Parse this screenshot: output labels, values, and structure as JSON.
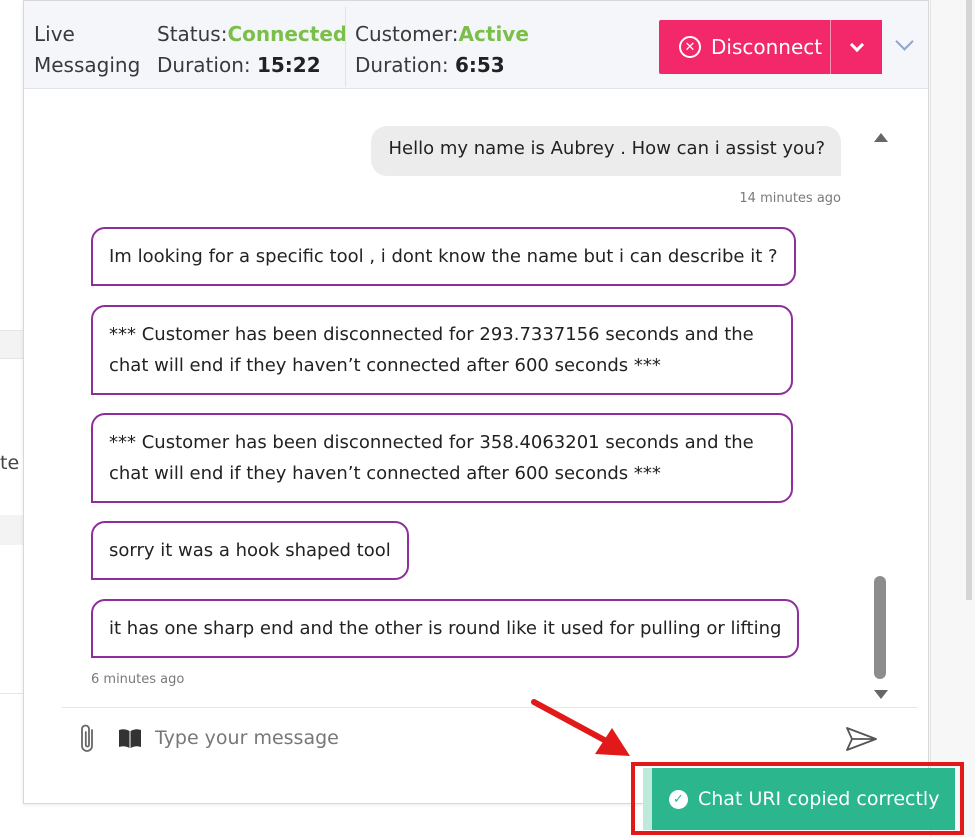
{
  "header": {
    "title_line1": "Live",
    "title_line2": "Messaging",
    "status_label": "Status:",
    "status_value": "Connected",
    "duration_label": "Duration:",
    "duration_value": "15:22",
    "customer_label": "Customer:",
    "customer_value": "Active",
    "customer_duration_label": "Duration:",
    "customer_duration_value": "6:53",
    "disconnect_label": "Disconnect",
    "accent_color": "#f2286b",
    "status_color": "#7bbf4a"
  },
  "background": {
    "partial_text": "te"
  },
  "messages": {
    "agent": {
      "text": "Hello my name is Aubrey . How can i assist you?",
      "time": "14 minutes ago"
    },
    "customer": [
      {
        "text": "Im looking for a specific tool , i dont know the name but i can describe it ?"
      },
      {
        "text": "*** Customer has been disconnected for 293.7337156 seconds and the chat will end if they haven’t connected after 600 seconds ***"
      },
      {
        "text": "*** Customer has been disconnected for 358.4063201 seconds and the chat will end if they haven’t connected after 600 seconds ***"
      },
      {
        "text": "sorry it was a hook shaped tool"
      },
      {
        "text": "it has one sharp end and the other is round like it used for pulling or lifting"
      }
    ],
    "customer_time": "6 minutes ago",
    "customer_border_color": "#8e2f9c"
  },
  "composer": {
    "placeholder": "Type your message",
    "value": ""
  },
  "toast": {
    "text": "Chat URI copied correctly",
    "color": "#2bb68d",
    "highlight_color": "#e11919"
  }
}
